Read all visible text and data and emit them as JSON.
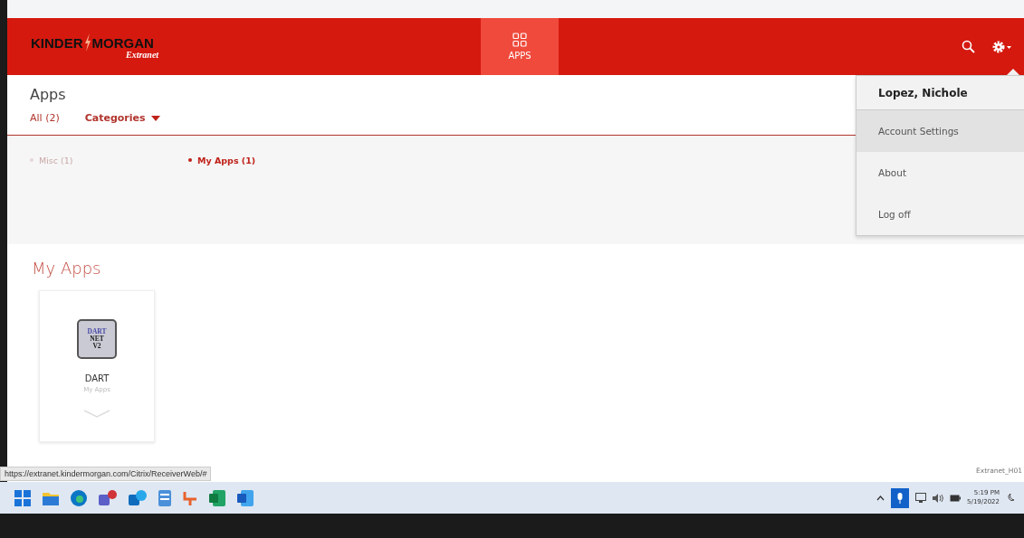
{
  "header": {
    "logo": {
      "left": "KINDER",
      "right": "MORGAN",
      "sub": "Extranet"
    },
    "nav": [
      {
        "label": "APPS",
        "selected": true
      }
    ]
  },
  "page": {
    "title": "Apps",
    "tabs": [
      {
        "label": "All (2)",
        "selected": false,
        "kind": "link"
      },
      {
        "label": "Categories",
        "selected": true,
        "kind": "dropdown"
      }
    ],
    "categories": [
      {
        "label": "Misc (1)",
        "selected": false
      },
      {
        "label": "My Apps (1)",
        "selected": true
      }
    ],
    "section_title": "My Apps",
    "apps": [
      {
        "name": "DART",
        "category": "My Apps",
        "icon_lines": [
          "DART",
          "NET",
          "V2"
        ]
      }
    ]
  },
  "user_menu": {
    "user": "Lopez, Nichole",
    "items": [
      {
        "label": "Account Settings",
        "hovered": true
      },
      {
        "label": "About",
        "hovered": false
      },
      {
        "label": "Log off",
        "hovered": false
      }
    ]
  },
  "status_url": "https://extranet.kindermorgan.com/Citrix/ReceiverWeb/#",
  "corner_label": "Extranet_H01",
  "taskbar": {
    "apps": [
      {
        "kind": "start"
      },
      {
        "kind": "folder"
      },
      {
        "kind": "browser"
      },
      {
        "kind": "chat"
      },
      {
        "kind": "mail"
      },
      {
        "kind": "notepad"
      },
      {
        "kind": "snip"
      },
      {
        "kind": "sheet"
      },
      {
        "kind": "doc"
      }
    ],
    "time": "5:19 PM",
    "date": "5/19/2022"
  }
}
